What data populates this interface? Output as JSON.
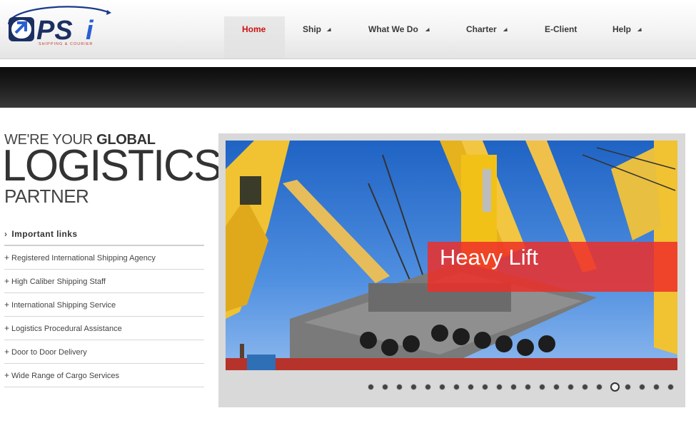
{
  "header": {
    "logo_text": "PSi",
    "logo_tagline": "SHIPPING & COURIER",
    "nav": [
      {
        "label": "Home",
        "active": true,
        "has_arrow": false
      },
      {
        "label": "Ship",
        "active": false,
        "has_arrow": true
      },
      {
        "label": "What We Do",
        "active": false,
        "has_arrow": true
      },
      {
        "label": "Charter",
        "active": false,
        "has_arrow": true
      },
      {
        "label": "E-Client",
        "active": false,
        "has_arrow": false
      },
      {
        "label": "Help",
        "active": false,
        "has_arrow": true
      }
    ]
  },
  "tagline": {
    "line1_prefix": "WE'RE YOUR",
    "line1_bold": "GLOBAL",
    "line2": "LOGISTICS",
    "line3": "PARTNER"
  },
  "links": {
    "heading": "Important links",
    "items": [
      "Registered International Shipping Agency",
      "High Caliber Shipping Staff",
      "International Shipping Service",
      "Logistics Procedural Assistance",
      "Door to Door Delivery",
      "Wide Range of Cargo Services"
    ]
  },
  "slider": {
    "caption": "Heavy Lift",
    "dot_count": 22,
    "active_dot": 17
  },
  "colors": {
    "accent_red": "#cc1212",
    "caption_red": "#ef2e28",
    "logo_blue": "#1a3a8a"
  }
}
